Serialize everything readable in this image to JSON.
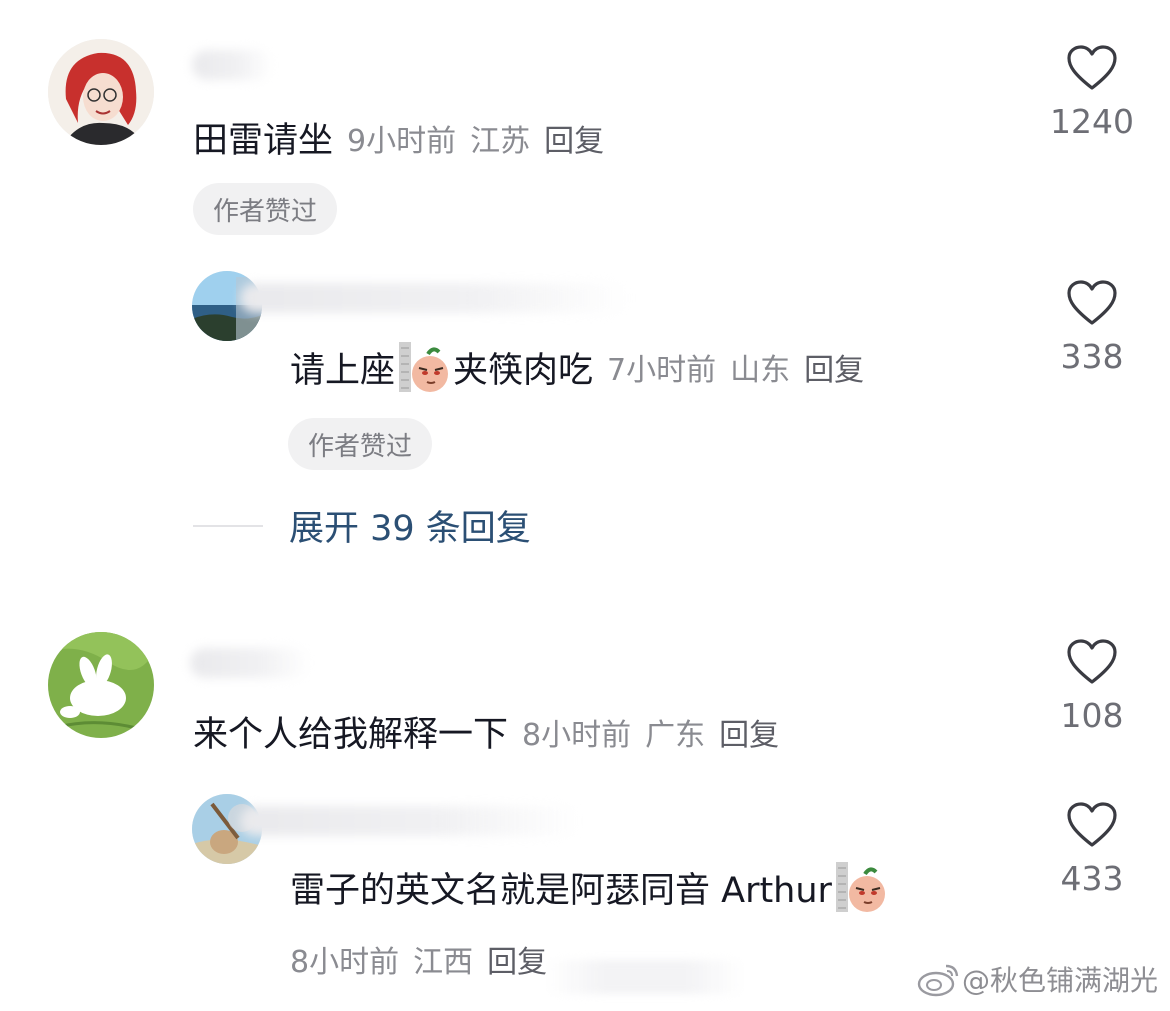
{
  "comments": [
    {
      "text": "田雷请坐",
      "time": "9小时前",
      "location": "江苏",
      "reply_label": "回复",
      "author_badge": "作者赞过",
      "likes": "1240"
    },
    {
      "text_prefix": "请上座",
      "text_suffix": "夹筷肉吃",
      "time": "7小时前",
      "location": "山东",
      "reply_label": "回复",
      "author_badge": "作者赞过",
      "likes": "338"
    },
    {
      "text": "来个人给我解释一下",
      "time": "8小时前",
      "location": "广东",
      "reply_label": "回复",
      "likes": "108"
    },
    {
      "text": "雷子的英文名就是阿瑟同音 Arthur",
      "time": "8小时前",
      "location": "江西",
      "reply_label": "回复",
      "likes": "433"
    }
  ],
  "expand_replies": "展开 39 条回复",
  "watermark": "@秋色铺满湖光",
  "icons": {
    "like": "heart-outline-icon",
    "sticker": "peanut-doll-sticker",
    "weibo": "weibo-logo-icon"
  }
}
